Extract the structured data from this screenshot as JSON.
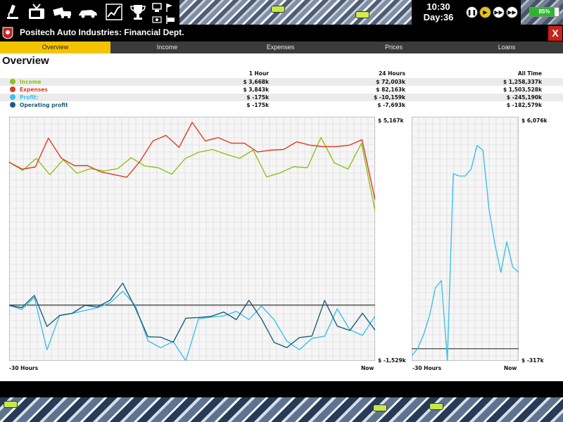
{
  "hud": {
    "time": "10:30",
    "day": "Day:36",
    "battery_label": "85%",
    "battery_level": 0.85,
    "icons": [
      "research-microscope-icon",
      "tv-marketing-icon",
      "money-cars-icon",
      "car-sales-icon",
      "chart-finance-icon",
      "trophy-icon",
      "computer-icon",
      "flag-icon"
    ],
    "speed_buttons": [
      "pause-icon",
      "play-icon",
      "fast-forward-icon",
      "fastest-forward-icon"
    ]
  },
  "panel": {
    "title": "Positech Auto Industries: Financial Dept.",
    "close_label": "X",
    "tabs": [
      {
        "label": "Overview",
        "active": true
      },
      {
        "label": "Income",
        "active": false
      },
      {
        "label": "Expenses",
        "active": false
      },
      {
        "label": "Prices",
        "active": false
      },
      {
        "label": "Loans",
        "active": false
      }
    ],
    "heading": "Overview"
  },
  "summary": {
    "columns": [
      "1 Hour",
      "24 Hours",
      "All Time"
    ],
    "rows": [
      {
        "label": "Income",
        "color": "#8dc21f",
        "values": [
          "$ 3,668k",
          "$ 72,003k",
          "$ 1,258,337k"
        ]
      },
      {
        "label": "Expenses",
        "color": "#e03b24",
        "values": [
          "$ 3,843k",
          "$ 82,163k",
          "$ 1,503,528k"
        ]
      },
      {
        "label": "Profit:",
        "color": "#3dc0ea",
        "values": [
          "$ -175k",
          "$ -10,159k",
          "$ -245,190k"
        ]
      },
      {
        "label": "Operating profit",
        "color": "#1a5f7a",
        "values": [
          "$ -175k",
          "$ -7,693k",
          "$ -182,579k"
        ]
      }
    ]
  },
  "chart_data": [
    {
      "type": "line",
      "x_labels": [
        "-30 Hours",
        "Now"
      ],
      "y_max_label": "$ 5,167k",
      "y_min_label": "$ -1,529k",
      "ylim": [
        -1529,
        5167
      ],
      "grid": true,
      "series": [
        {
          "name": "Income",
          "color": "#8dc21f",
          "values": [
            3920,
            3693,
            4025,
            3578,
            3988,
            3616,
            3742,
            3680,
            3742,
            4044,
            3818,
            3768,
            3593,
            4025,
            4195,
            4270,
            4139,
            4026,
            4253,
            3516,
            3629,
            3797,
            3767,
            4598,
            3900,
            3732,
            4440,
            2580
          ]
        },
        {
          "name": "Expenses",
          "color": "#e03b24",
          "values": [
            3920,
            3730,
            3788,
            4580,
            4026,
            3826,
            3826,
            3656,
            3580,
            3505,
            3938,
            4504,
            4656,
            4327,
            5013,
            4504,
            4596,
            4442,
            4442,
            4200,
            4250,
            4270,
            4480,
            4390,
            4347,
            4347,
            4384,
            4536,
            2883
          ]
        },
        {
          "name": "Profit:",
          "color": "#3dc0ea",
          "values": [
            -7,
            -120,
            208,
            -1228,
            -285,
            -228,
            -150,
            -73,
            61,
            377,
            -13,
            -980,
            -1170,
            -1000,
            -1529,
            -378,
            -330,
            -298,
            -170,
            -397,
            -25,
            -404,
            -987,
            -1225,
            -912,
            -856,
            -100,
            -680,
            -830,
            -300
          ]
        },
        {
          "name": "Operating profit",
          "color": "#1a5f7a",
          "values": [
            -7,
            -73,
            265,
            -586,
            -286,
            -225,
            -7,
            -50,
            132,
            603,
            -80,
            -870,
            -880,
            -1020,
            -360,
            -340,
            -310,
            -190,
            -400,
            131,
            -380,
            -1025,
            -1166,
            -890,
            -850,
            126,
            -577,
            -697,
            -222,
            -690
          ]
        }
      ]
    },
    {
      "type": "line",
      "x_labels": [
        "-30 Hours",
        "Now"
      ],
      "y_max_label": "$ 6,076k",
      "y_min_label": "$ -317k",
      "ylim": [
        -317,
        6076
      ],
      "grid": true,
      "series": [
        {
          "name": "Profit:",
          "color": "#3dc0ea",
          "values": [
            -185,
            0,
            369,
            862,
            1600,
            1785,
            -317,
            4584,
            4522,
            4522,
            4707,
            5323,
            5200,
            3661,
            2738,
            2000,
            2800,
            2138,
            2000
          ]
        }
      ]
    }
  ]
}
